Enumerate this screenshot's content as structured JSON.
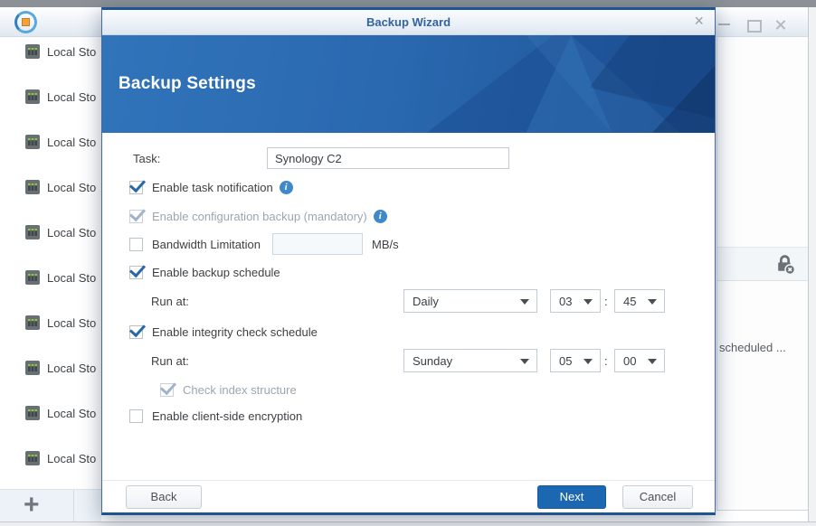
{
  "colors": {
    "accent_blue": "#2e6fb5",
    "primary_button": "#1b67b2",
    "check_blue": "#2a67a8",
    "title_text": "#33639e",
    "info_icon": "#3f88c9",
    "banner_deep_blue": "#1e5295"
  },
  "background": {
    "app_icon": "hyper-backup-icon",
    "window_controls": [
      "minimize",
      "maximize",
      "close"
    ],
    "list_items": [
      "Local Sto",
      "Local Sto",
      "Local Sto",
      "Local Sto",
      "Local Sto",
      "Local Sto",
      "Local Sto",
      "Local Sto",
      "Local Sto",
      "Local Sto"
    ],
    "add_button_glyph": "+",
    "right_panel": {
      "truncated_text": "scheduled ...",
      "lock_icon": "lock-with-x-icon"
    }
  },
  "dialog": {
    "title": "Backup Wizard",
    "close_glyph": "×",
    "banner_title": "Backup Settings",
    "form": {
      "task_label": "Task:",
      "task_value": "Synology C2",
      "notification_label": "Enable task notification",
      "notification_checked": true,
      "config_backup_label": "Enable configuration backup (mandatory)",
      "config_backup_checked": true,
      "config_backup_disabled": true,
      "bandwidth_label": "Bandwidth Limitation",
      "bandwidth_value": "",
      "bandwidth_unit": "MB/s",
      "bandwidth_checked": false,
      "backup_schedule_label": "Enable backup schedule",
      "backup_schedule_checked": true,
      "run_at_label": "Run at:",
      "backup_day": "Daily",
      "backup_hour": "03",
      "backup_minute": "45",
      "time_separator": ":",
      "integrity_label": "Enable integrity check schedule",
      "integrity_checked": true,
      "integrity_run_at_label": "Run at:",
      "integrity_day": "Sunday",
      "integrity_hour": "05",
      "integrity_minute": "00",
      "check_index_label": "Check index structure",
      "check_index_checked": true,
      "check_index_disabled": true,
      "encryption_label": "Enable client-side encryption",
      "encryption_checked": false
    },
    "footer": {
      "back_label": "Back",
      "next_label": "Next",
      "cancel_label": "Cancel"
    }
  },
  "icons": {
    "info_glyph": "i"
  }
}
